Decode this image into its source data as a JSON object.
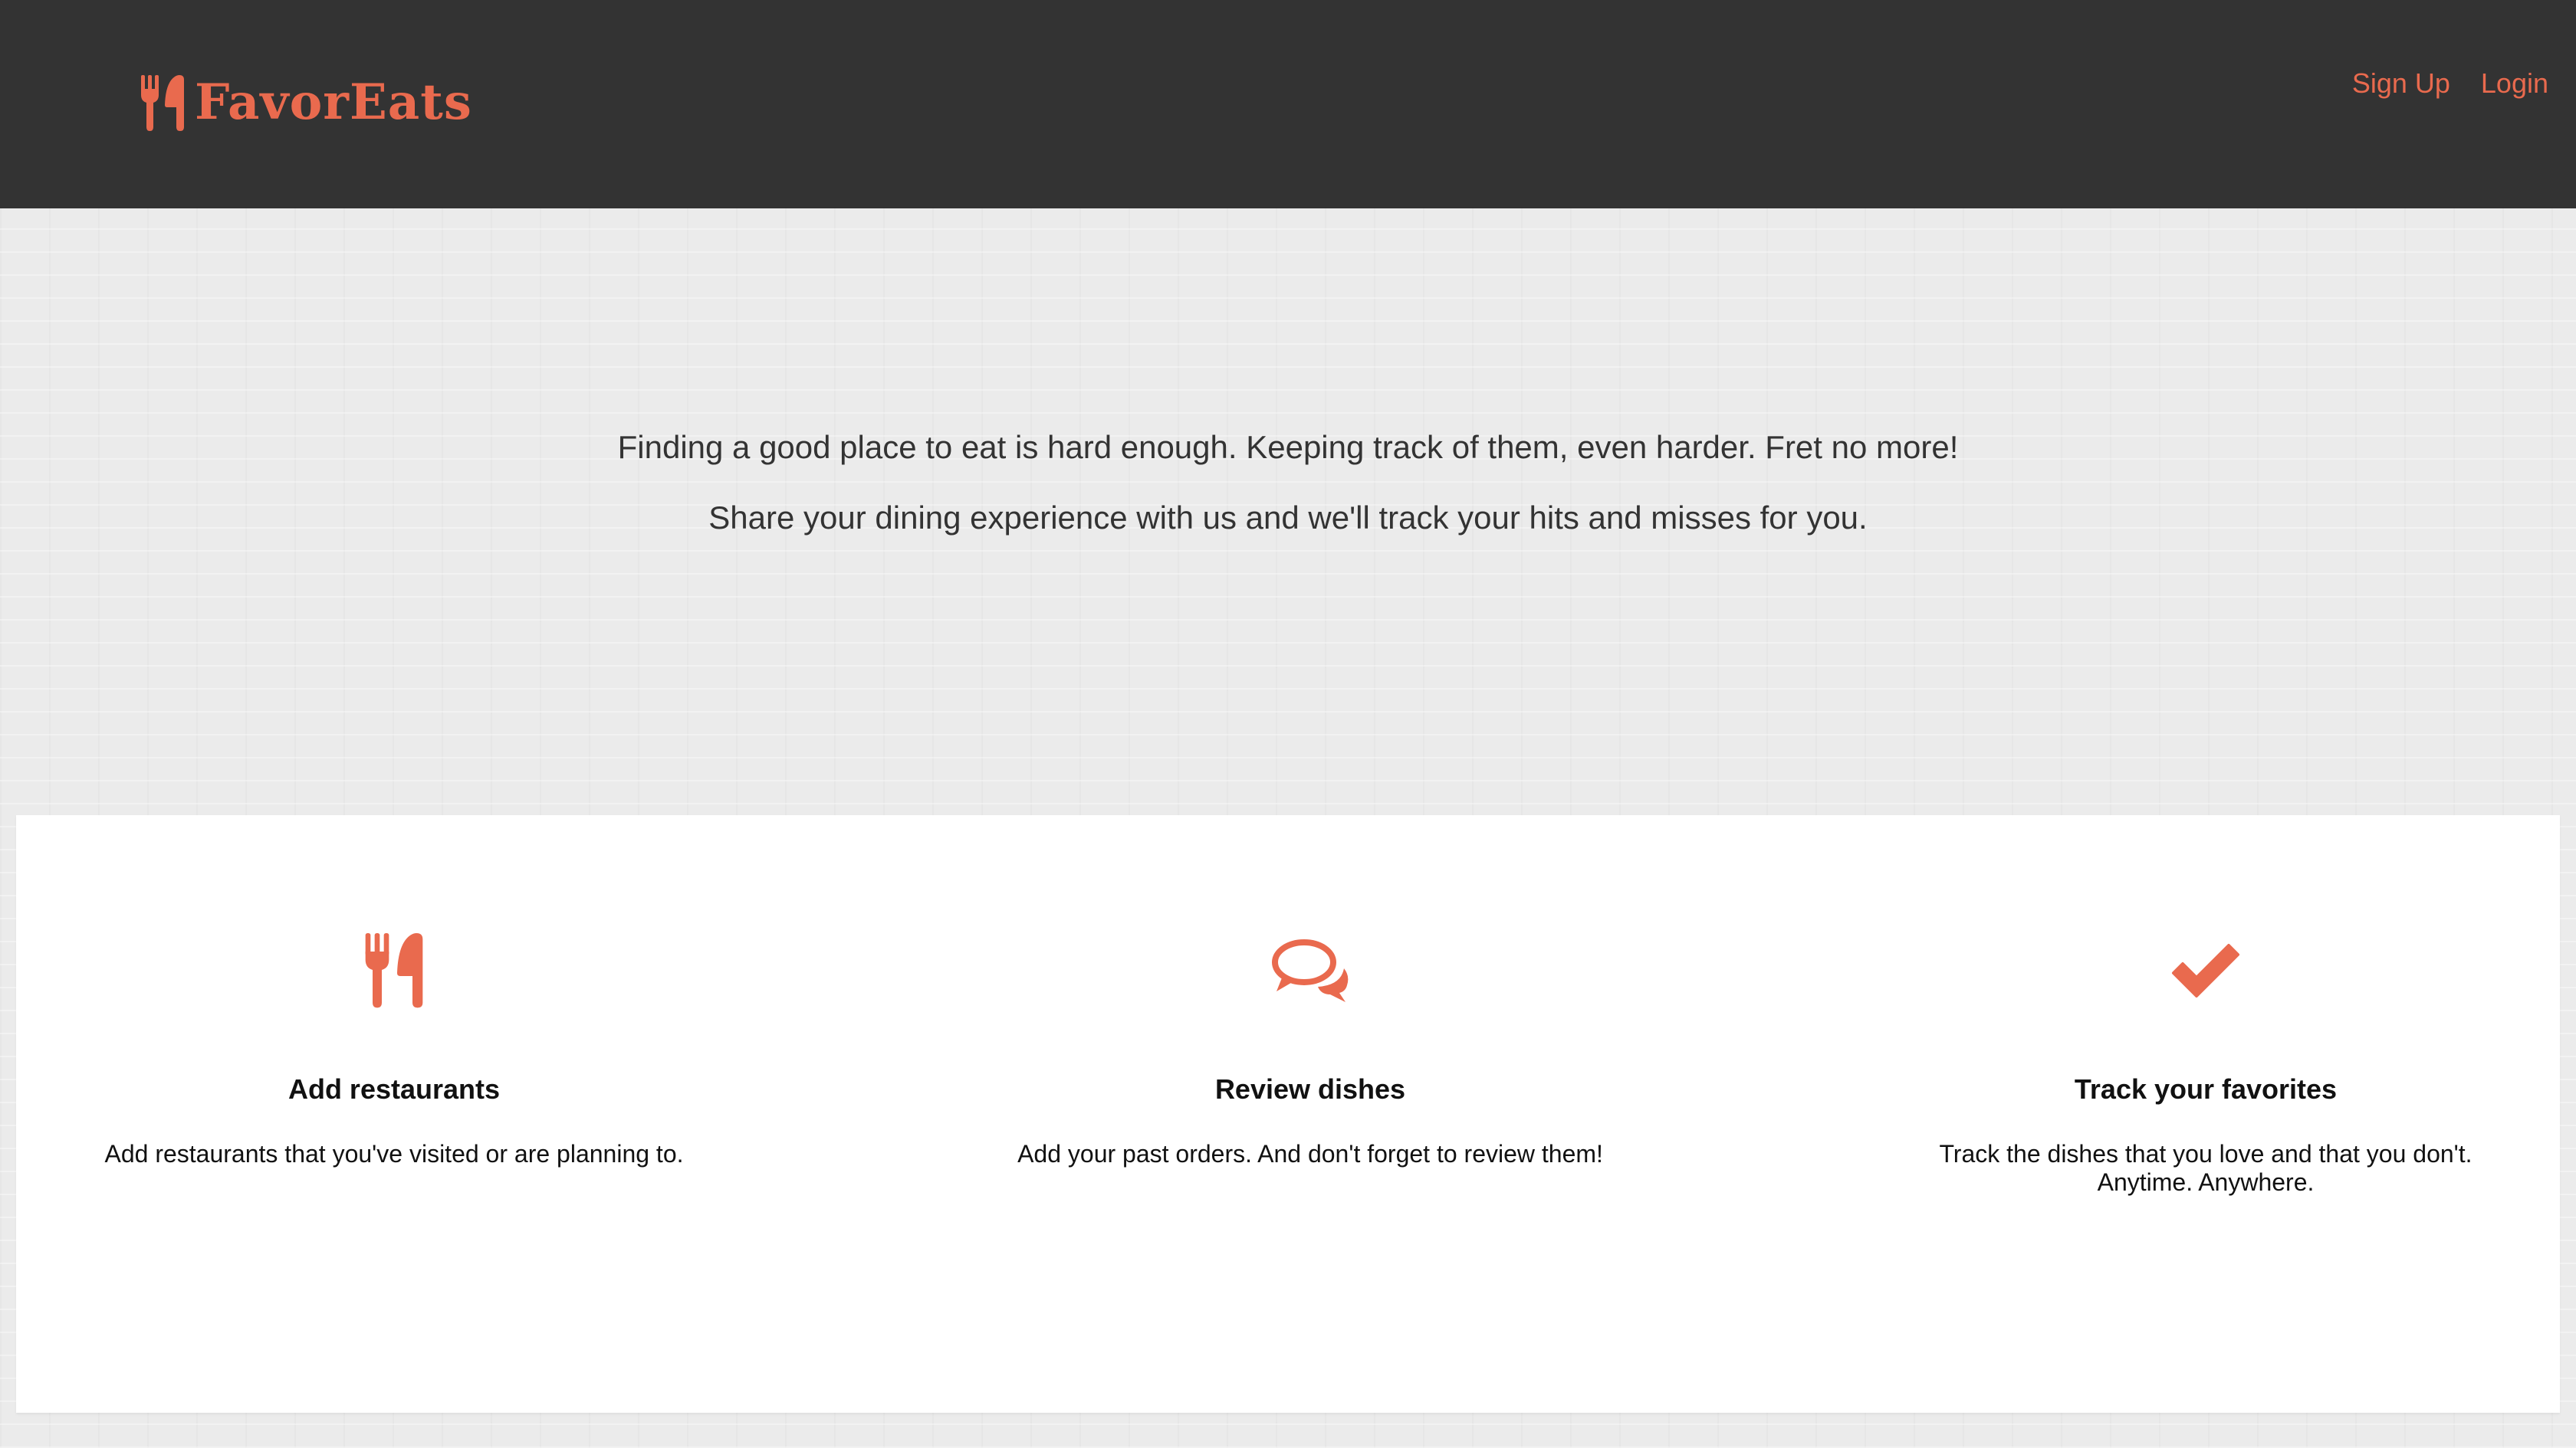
{
  "header": {
    "brand_name": "FavorEats",
    "brand_icon": "utensils-icon",
    "nav": {
      "signup_label": "Sign Up",
      "login_label": "Login"
    }
  },
  "hero": {
    "line1": "Finding a good place to eat is hard enough. Keeping track of them, even harder. Fret no more!",
    "line2": "Share your dining experience with us and we'll track your hits and misses for you."
  },
  "features": [
    {
      "icon": "utensils-icon",
      "title": "Add restaurants",
      "description_lines": [
        "Add restaurants that you've visited or are planning to."
      ]
    },
    {
      "icon": "comments-icon",
      "title": "Review dishes",
      "description_lines": [
        "Add your past orders. And don't forget to review them!"
      ]
    },
    {
      "icon": "checkmark-icon",
      "title": "Track your favorites",
      "description_lines": [
        "Track the dishes that you love and that you don't.",
        "Anytime. Anywhere."
      ]
    }
  ],
  "colors": {
    "accent": "#e96a4e",
    "header_bg": "#333333",
    "page_bg": "#ebebeb",
    "card_bg": "#ffffff",
    "text": "#333333"
  }
}
